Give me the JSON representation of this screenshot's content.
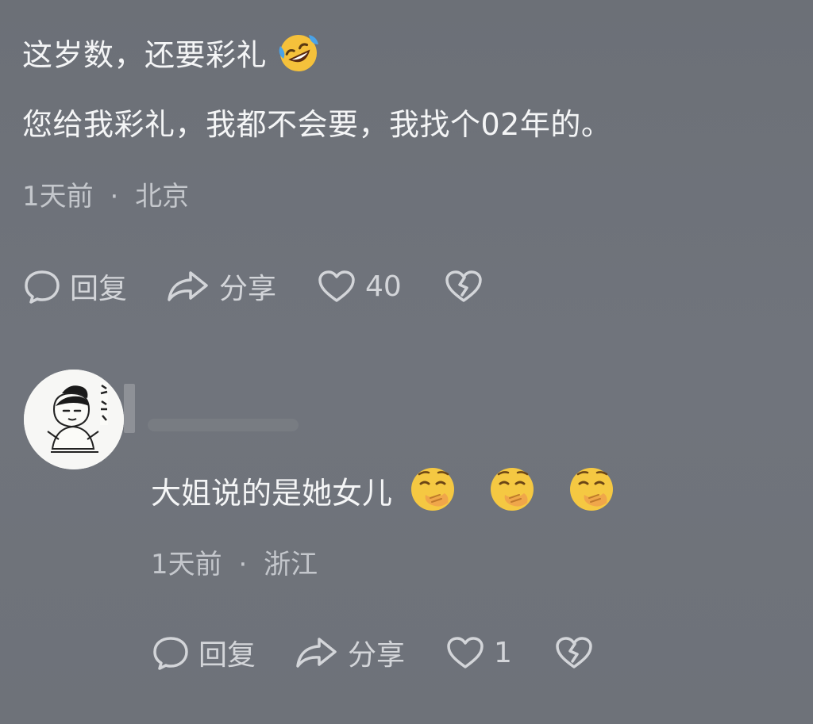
{
  "comment1": {
    "line1_text": "这岁数，还要彩礼",
    "line1_emoji": "rolling-on-floor-laughing-emoji",
    "line2_text": "您给我彩礼，我都不会要，我找个02年的。",
    "time": "1天前",
    "separator": "·",
    "location": "北京",
    "actions": {
      "reply_label": "回复",
      "share_label": "分享",
      "like_count": "40"
    }
  },
  "comment2": {
    "avatar": "cartoon-avatar",
    "text": "大姐说的是她女儿",
    "emojis": [
      "face-with-hand-over-mouth-emoji",
      "face-with-hand-over-mouth-emoji",
      "face-with-hand-over-mouth-emoji"
    ],
    "time": "1天前",
    "separator": "·",
    "location": "浙江",
    "actions": {
      "reply_label": "回复",
      "share_label": "分享",
      "like_count": "1"
    }
  },
  "colors": {
    "background": "#6f737b",
    "text": "#f4f5f6",
    "meta": "#c4c7cc",
    "emoji_yellow": "#f5c842"
  }
}
